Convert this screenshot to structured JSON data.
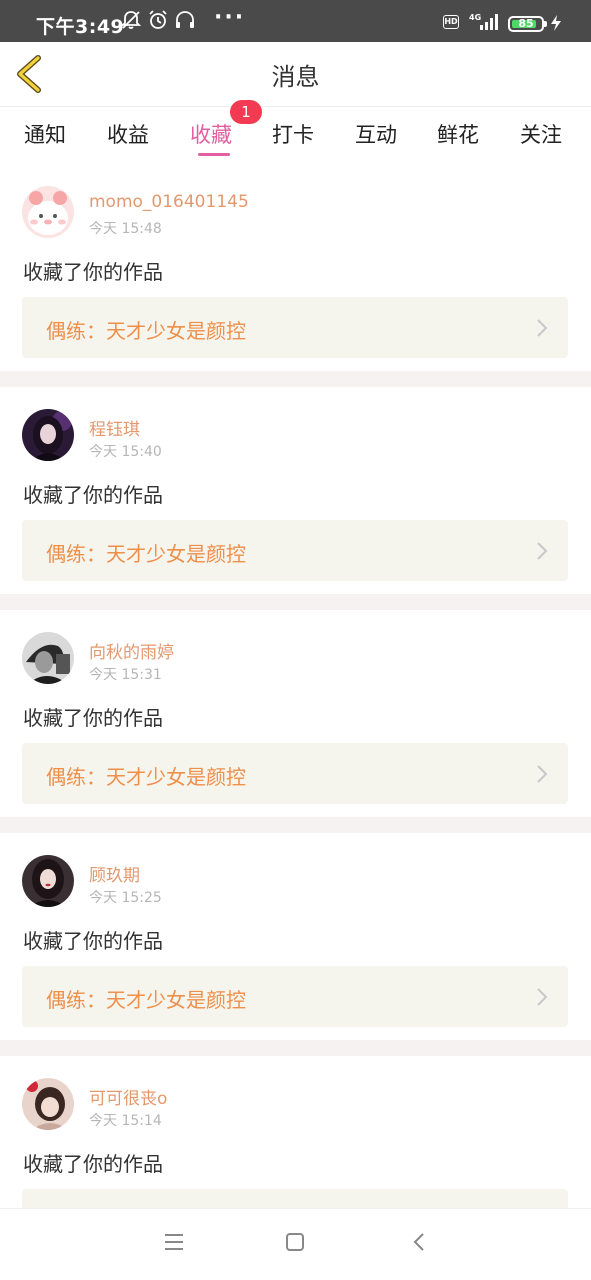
{
  "status_bar": {
    "time": "下午3:49",
    "more": "···",
    "hd": "HD",
    "network": "4G",
    "battery": "85",
    "battery_level": 0.85,
    "icons": [
      "mute-icon",
      "alarm-icon",
      "headset-icon",
      "signal-icon",
      "charging-icon"
    ]
  },
  "header": {
    "title": "消息",
    "back_icon": "chevron-left-icon"
  },
  "tabs": {
    "items": [
      {
        "label": "通知",
        "active": false
      },
      {
        "label": "收益",
        "active": false
      },
      {
        "label": "收藏",
        "active": true,
        "badge": "1"
      },
      {
        "label": "打卡",
        "active": false
      },
      {
        "label": "互动",
        "active": false
      },
      {
        "label": "鲜花",
        "active": false
      },
      {
        "label": "关注",
        "active": false
      }
    ],
    "active_color": "#e35fa0",
    "badge_color": "#f23b53"
  },
  "messages": [
    {
      "username": "momo_016401145",
      "time": "今天 15:48",
      "action": "收藏了你的作品",
      "work": "偶练：天才少女是颜控"
    },
    {
      "username": "程钰琪",
      "time": "今天 15:40",
      "action": "收藏了你的作品",
      "work": "偶练：天才少女是颜控"
    },
    {
      "username": "向秋的雨婷",
      "time": "今天 15:31",
      "action": "收藏了你的作品",
      "work": "偶练：天才少女是颜控"
    },
    {
      "username": "顾玖期",
      "time": "今天 15:25",
      "action": "收藏了你的作品",
      "work": "偶练：天才少女是颜控"
    },
    {
      "username": "可可很丧o",
      "time": "今天 15:14",
      "action": "收藏了你的作品",
      "work": ""
    }
  ],
  "colors": {
    "username": "#e4986e",
    "work_title": "#ee8f4a",
    "work_box": "#f5f5ee",
    "separator": "#f7f2f2"
  },
  "navbar": {
    "icons": [
      "menu-icon",
      "home-square-icon",
      "back-triangle-icon"
    ]
  }
}
